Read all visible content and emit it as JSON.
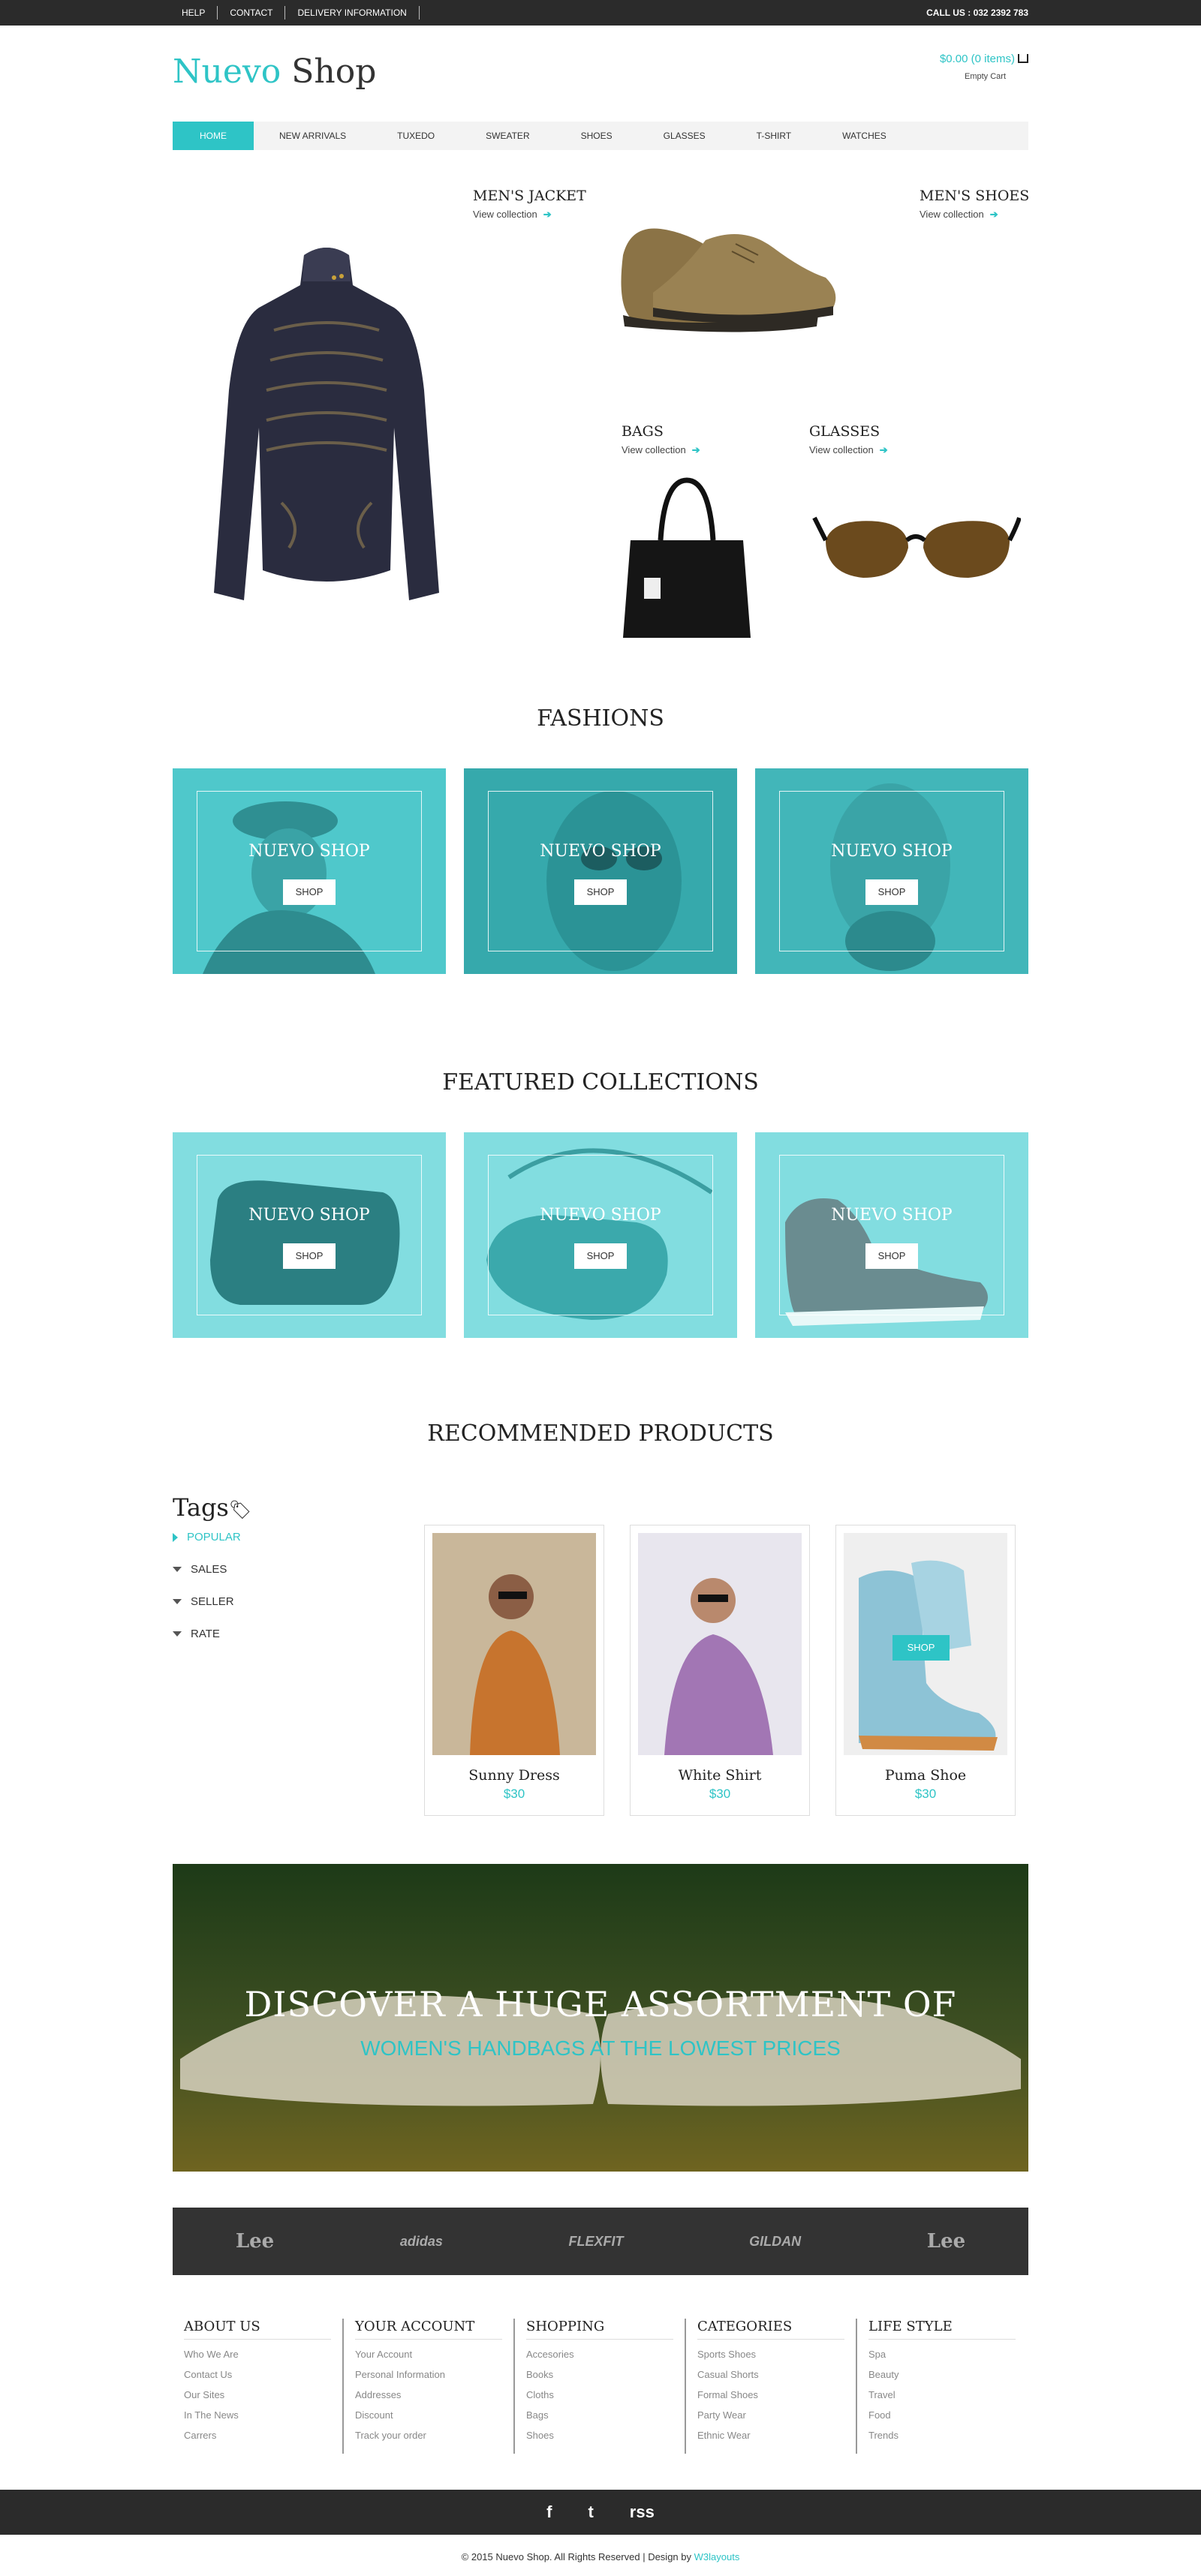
{
  "topbar": {
    "links": [
      "HELP",
      "CONTACT",
      "DELIVERY INFORMATION"
    ],
    "call": "CALL US : 032 2392 783"
  },
  "logo": {
    "part1": "Nuevo",
    "part2": " Shop"
  },
  "cart": {
    "amount": "$0.00 (0 items)",
    "empty": "Empty Cart"
  },
  "nav": [
    "HOME",
    "NEW ARRIVALS",
    "TUXEDO",
    "SWEATER",
    "SHOES",
    "GLASSES",
    "T-SHIRT",
    "WATCHES"
  ],
  "hero": {
    "jacket": {
      "title": "MEN'S JACKET",
      "link": "View collection"
    },
    "shoes": {
      "title": "MEN'S SHOES",
      "link": "View collection"
    },
    "bags": {
      "title": "BAGS",
      "link": "View collection"
    },
    "glasses": {
      "title": "GLASSES",
      "link": "View collection"
    }
  },
  "fashions": {
    "title": "FASHIONS",
    "tiles": [
      {
        "title": "NUEVO SHOP",
        "button": "SHOP"
      },
      {
        "title": "NUEVO SHOP",
        "button": "SHOP"
      },
      {
        "title": "NUEVO SHOP",
        "button": "SHOP"
      }
    ]
  },
  "featured": {
    "title": "FEATURED COLLECTIONS",
    "tiles": [
      {
        "title": "NUEVO SHOP",
        "button": "SHOP"
      },
      {
        "title": "NUEVO SHOP",
        "button": "SHOP"
      },
      {
        "title": "NUEVO SHOP",
        "button": "SHOP"
      }
    ]
  },
  "recommended": {
    "title": "RECOMMENDED PRODUCTS"
  },
  "tags": {
    "title": "Tags",
    "items": [
      "POPULAR",
      "SALES",
      "SELLER",
      "RATE"
    ]
  },
  "products": [
    {
      "name": "Sunny Dress",
      "price": "$30"
    },
    {
      "name": "White Shirt",
      "price": "$30"
    },
    {
      "name": "Puma Shoe",
      "price": "$30",
      "button": "SHOP"
    }
  ],
  "banner": {
    "line1": "DISCOVER A HUGE ASSORTMENT OF",
    "line2": "WOMEN'S HANDBAGS AT THE LOWEST PRICES"
  },
  "footer": {
    "columns": [
      {
        "heading": "ABOUT US",
        "items": [
          "Who We Are",
          "Contact Us",
          "Our Sites",
          "In The News",
          "Carrers"
        ]
      },
      {
        "heading": "YOUR ACCOUNT",
        "items": [
          "Your Account",
          "Personal Information",
          "Addresses",
          "Discount",
          "Track your order"
        ]
      },
      {
        "heading": "SHOPPING",
        "items": [
          "Accesories",
          "Books",
          "Cloths",
          "Bags",
          "Shoes"
        ]
      },
      {
        "heading": "CATEGORIES",
        "items": [
          "Sports Shoes",
          "Casual Shorts",
          "Formal Shoes",
          "Party Wear",
          "Ethnic Wear"
        ]
      },
      {
        "heading": "LIFE STYLE",
        "items": [
          "Spa",
          "Beauty",
          "Travel",
          "Food",
          "Trends"
        ]
      }
    ],
    "social": [
      "f",
      "t",
      "rss"
    ],
    "copyright": "© 2015 Nuevo Shop. All Rights Reserved | Design by ",
    "designer": "W3layouts"
  },
  "colors": {
    "accent": "#2ec4c6",
    "dark": "#2b2b2b"
  }
}
